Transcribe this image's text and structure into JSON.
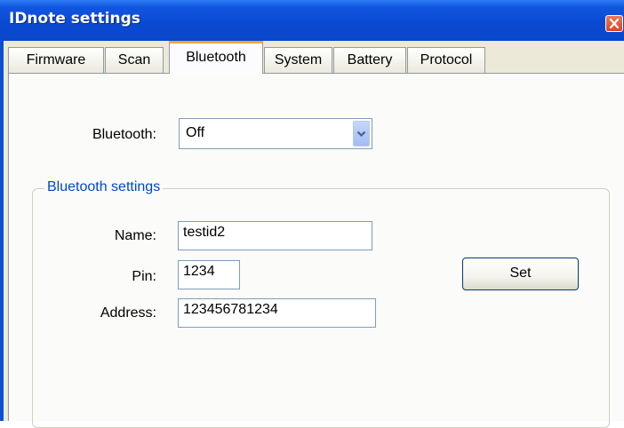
{
  "window": {
    "title": "IDnote settings"
  },
  "tabs": [
    {
      "label": "Firmware",
      "active": false
    },
    {
      "label": "Scan",
      "active": false
    },
    {
      "label": "Bluetooth",
      "active": true
    },
    {
      "label": "System",
      "active": false
    },
    {
      "label": "Battery",
      "active": false
    },
    {
      "label": "Protocol",
      "active": false
    }
  ],
  "bluetooth": {
    "label": "Bluetooth:",
    "selected": "Off"
  },
  "settings_group": {
    "title": "Bluetooth settings",
    "name_label": "Name:",
    "name_value": "testid2",
    "pin_label": "Pin:",
    "pin_value": "1234",
    "address_label": "Address:",
    "address_value": "123456781234",
    "set_label": "Set"
  },
  "colors": {
    "titlebar": "#0a4ad2",
    "active_tab_accent": "#f7a43a",
    "group_title": "#0046d5"
  }
}
